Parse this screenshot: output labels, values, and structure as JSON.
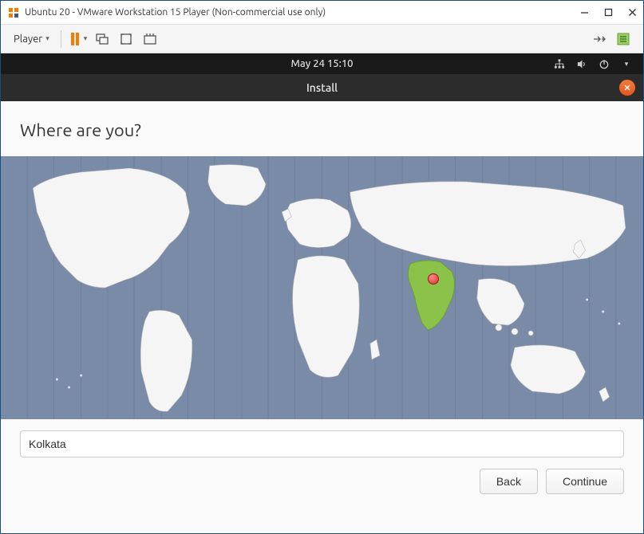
{
  "vmware": {
    "title": "Ubuntu 20 - VMware Workstation 15 Player (Non-commercial use only)",
    "player_menu": "Player"
  },
  "gnome": {
    "datetime": "May 24  15:10"
  },
  "installer": {
    "window_title": "Install",
    "heading": "Where are you?",
    "timezone_value": "Kolkata",
    "back_label": "Back",
    "continue_label": "Continue"
  },
  "map": {
    "selected_region": "India",
    "pin_city": "Kolkata"
  },
  "colors": {
    "map_water": "#7a8ba8",
    "map_land": "#f2f2f2",
    "map_selected": "#8bc34a",
    "ubuntu_orange": "#e95420"
  }
}
